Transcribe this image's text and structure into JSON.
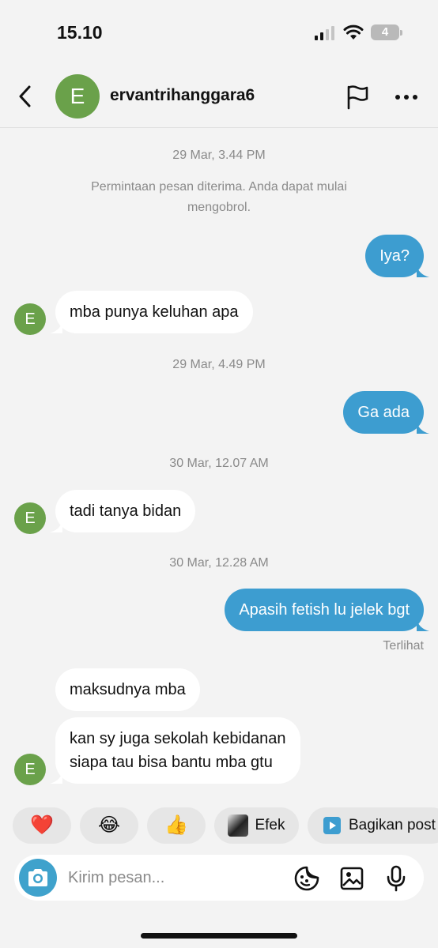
{
  "status_bar": {
    "time": "15.10",
    "battery_level": "4",
    "signal_icon": "signal-bars-icon",
    "wifi_icon": "wifi-icon"
  },
  "header": {
    "avatar_letter": "E",
    "username": "ervantrihanggara6",
    "avatar_color": "#6aa14a",
    "icons": [
      "chevron-left-icon",
      "flag-icon",
      "more-icon"
    ]
  },
  "chat": {
    "timestamps": [
      "29 Mar, 3.44 PM",
      "29 Mar, 4.49 PM",
      "30 Mar, 12.07 AM",
      "30 Mar, 12.28 AM"
    ],
    "system_note": "Permintaan pesan diterima. Anda dapat mulai mengobrol.",
    "messages": [
      {
        "side": "out",
        "text": "Iya?"
      },
      {
        "side": "in",
        "text": "mba punya keluhan apa"
      },
      {
        "side": "out",
        "text": "Ga ada"
      },
      {
        "side": "in",
        "text": "tadi tanya bidan"
      },
      {
        "side": "out",
        "text": "Apasih fetish lu jelek bgt"
      },
      {
        "side": "in",
        "text": "maksudnya mba"
      },
      {
        "side": "in",
        "text": "kan sy juga sekolah kebidanan\nsiapa tau bisa bantu mba gtu"
      }
    ],
    "seen_label": "Terlihat",
    "sender_avatar_letter": "E",
    "outgoing_color": "#3d9dd0",
    "incoming_color": "#ffffff"
  },
  "reactions": {
    "items": [
      {
        "emoji": "❤️"
      },
      {
        "emoji": "😂"
      },
      {
        "emoji": "👍"
      }
    ],
    "effect_label": "Efek",
    "share_label": "Bagikan post"
  },
  "composer": {
    "placeholder": "Kirim pesan...",
    "icons": [
      "camera-icon",
      "sticker-icon",
      "gallery-icon",
      "microphone-icon"
    ],
    "camera_color": "#3fa2cc"
  }
}
